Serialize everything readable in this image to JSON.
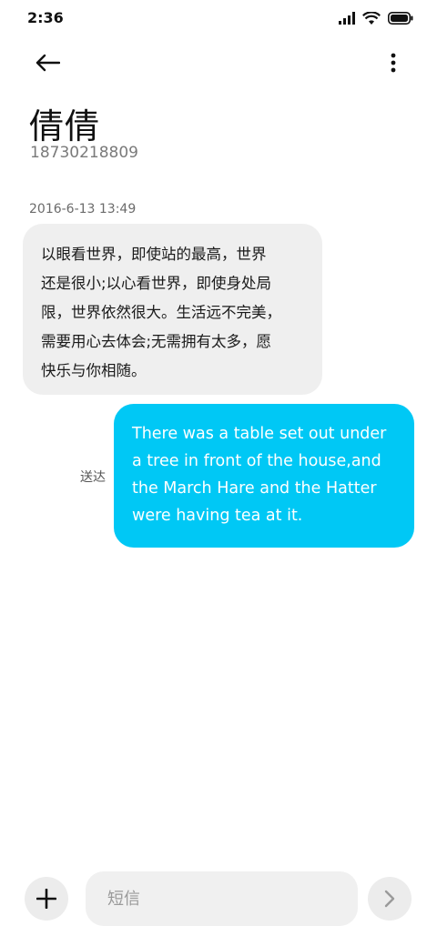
{
  "status_bar": {
    "time": "2:36",
    "icons": [
      "signal-icon",
      "wifi-icon",
      "battery-icon"
    ]
  },
  "header": {
    "back_icon": "back-arrow-icon",
    "more_icon": "more-vertical-icon",
    "contact_name": "倩倩",
    "contact_number": "18730218809"
  },
  "conversation": {
    "timestamp": "2016-6-13 13:49",
    "incoming_lines": [
      "以眼看世界，即使站的最高，世界",
      "还是很小;以心看世界，即使身处局",
      "限，世界依然很大。生活远不完美，",
      "需要用心去体会;无需拥有太多，愿",
      "快乐与你相随。"
    ],
    "outgoing_lines": [
      "There was a table set out under",
      "a tree in front of the house,and",
      "the March Hare and the Hatter",
      "were having tea at it."
    ],
    "delivered_label": "送达"
  },
  "composer": {
    "placeholder": "短信",
    "attach_icon": "plus-icon",
    "send_icon": "chevron-right-icon"
  },
  "colors": {
    "outgoing_bubble": "#00c8f5",
    "incoming_bubble": "#efefef",
    "background": "#ffffff"
  }
}
